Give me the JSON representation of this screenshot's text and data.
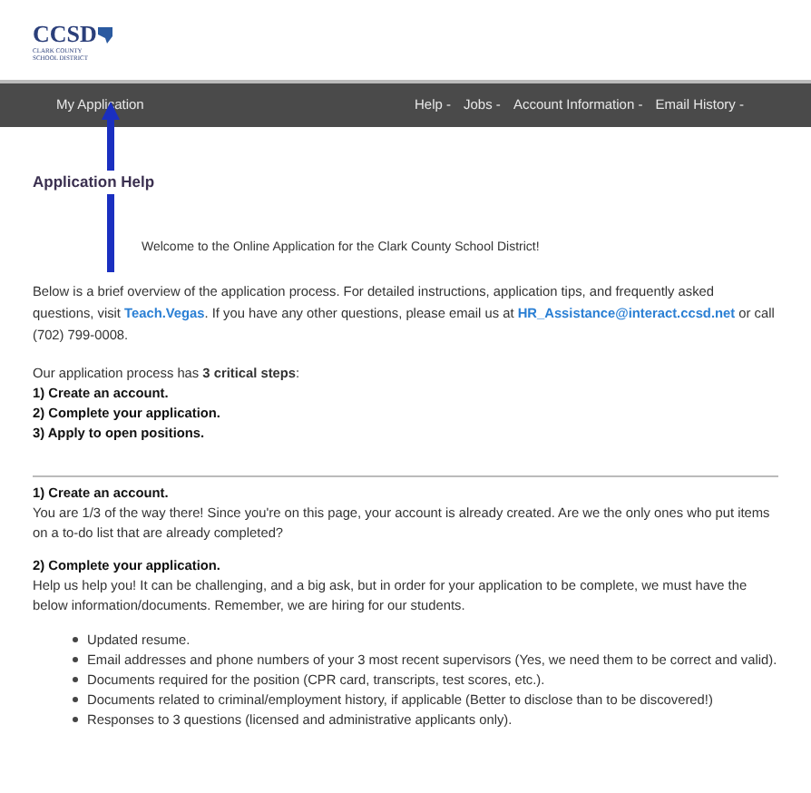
{
  "logo": {
    "mark": "CCSD",
    "subtitle": "CLARK COUNTY SCHOOL DISTRICT"
  },
  "nav": {
    "home": "My Application",
    "menus": [
      "Help -",
      "Jobs -",
      "Account Information -",
      "Email History -"
    ]
  },
  "title": "Application Help",
  "welcome": "Welcome to the Online Application for the Clark County School District!",
  "intro": [
    {
      "kind": "text",
      "text": "Below is a brief overview of the application process. For detailed instructions, application tips, and frequently asked questions, visit "
    },
    {
      "kind": "link",
      "text": "Teach.Vegas"
    },
    {
      "kind": "text",
      "text": ". If you have any other questions, please email us at "
    },
    {
      "kind": "link",
      "text": "HR_Assistance@interact.ccsd.net"
    },
    {
      "kind": "text",
      "text": " or call (702) 799-0008."
    }
  ],
  "steps_intro": "Our application process has **3 critical steps**:",
  "steps": [
    "1) Create an account.",
    "2) Complete your application.",
    "3) Apply to open positions."
  ],
  "sections": [
    {
      "heading": "1) Create an account.",
      "body": "You are 1/3 of the way there! Since you're on this page, your account is already created. Are we the only ones who put items on a to-do list that are already completed?"
    },
    {
      "heading": "2) Complete your application.",
      "body": "Help us help you! It can be challenging, and a big ask, but in order for your application to be complete, we must have the below information/documents. Remember, we are hiring for our students.",
      "items": [
        "Updated resume.",
        "Email addresses and phone numbers of your 3 most recent supervisors (Yes, we need them to be correct and valid).",
        "Documents required for the position (CPR card, transcripts, test scores, etc.).",
        "Documents related to criminal/employment history, if applicable (Better to disclose than to be discovered!)",
        "Responses to 3 questions (licensed and administrative applicants only)."
      ]
    }
  ]
}
